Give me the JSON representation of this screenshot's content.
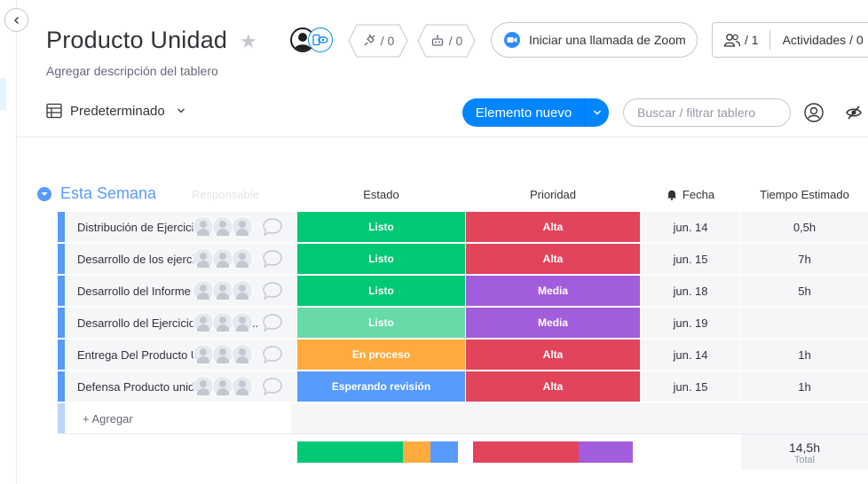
{
  "board": {
    "title": "Producto Unidad",
    "description": "Agregar descripción del tablero"
  },
  "header": {
    "integrations_count": "/ 0",
    "automations_count": "/ 0",
    "zoom_label": "Iniciar una llamada de Zoom",
    "members_count": "/ 1",
    "activity_label": "Actividades / 0"
  },
  "toolbar": {
    "view_label": "Predeterminado",
    "new_item_label": "Elemento nuevo",
    "search_placeholder": "Buscar / filtrar tablero"
  },
  "group": {
    "title": "Esta Semana",
    "color": "#579bfc",
    "ghost_column": "Responsable",
    "add_label": "+ Agregar"
  },
  "columns": {
    "status": "Estado",
    "priority": "Prioridad",
    "date": "Fecha",
    "time": "Tiempo Estimado"
  },
  "rows": [
    {
      "name": "Distribución de Ejercicios",
      "status": "Listo",
      "status_color": "#00c875",
      "priority": "Alta",
      "priority_color": "#e2445c",
      "date": "jun. 14",
      "time": "0,5h"
    },
    {
      "name": "Desarrollo de los ejercicios",
      "status": "Listo",
      "status_color": "#00c875",
      "priority": "Alta",
      "priority_color": "#e2445c",
      "date": "jun. 15",
      "time": "7h"
    },
    {
      "name": "Desarrollo del Informe",
      "status": "Listo",
      "status_color": "#00c875",
      "priority": "Media",
      "priority_color": "#a25ddc",
      "date": "jun. 18",
      "time": "5h"
    },
    {
      "name": "Desarrollo del Ejercicio en AppInv...",
      "status": "Listo",
      "status_color": "#66dba8",
      "priority": "Media",
      "priority_color": "#a25ddc",
      "date": "jun. 19",
      "time": ""
    },
    {
      "name": "Entrega Del Producto Unidad",
      "status": "En proceso",
      "status_color": "#fdab3d",
      "priority": "Alta",
      "priority_color": "#e2445c",
      "date": "jun. 14",
      "time": "1h"
    },
    {
      "name": "Defensa Producto unidad",
      "status": "Esperando revisión",
      "status_color": "#579bfc",
      "priority": "Alta",
      "priority_color": "#e2445c",
      "date": "jun. 15",
      "time": "1h"
    }
  ],
  "summary": {
    "status_segments": [
      {
        "fraction": 0.66,
        "color": "#00c875"
      },
      {
        "fraction": 0.17,
        "color": "#fdab3d"
      },
      {
        "fraction": 0.17,
        "color": "#579bfc"
      }
    ],
    "priority_segments": [
      {
        "fraction": 0.66,
        "color": "#e2445c"
      },
      {
        "fraction": 0.34,
        "color": "#a25ddc"
      }
    ],
    "total_value": "14,5h",
    "total_label": "Total"
  }
}
